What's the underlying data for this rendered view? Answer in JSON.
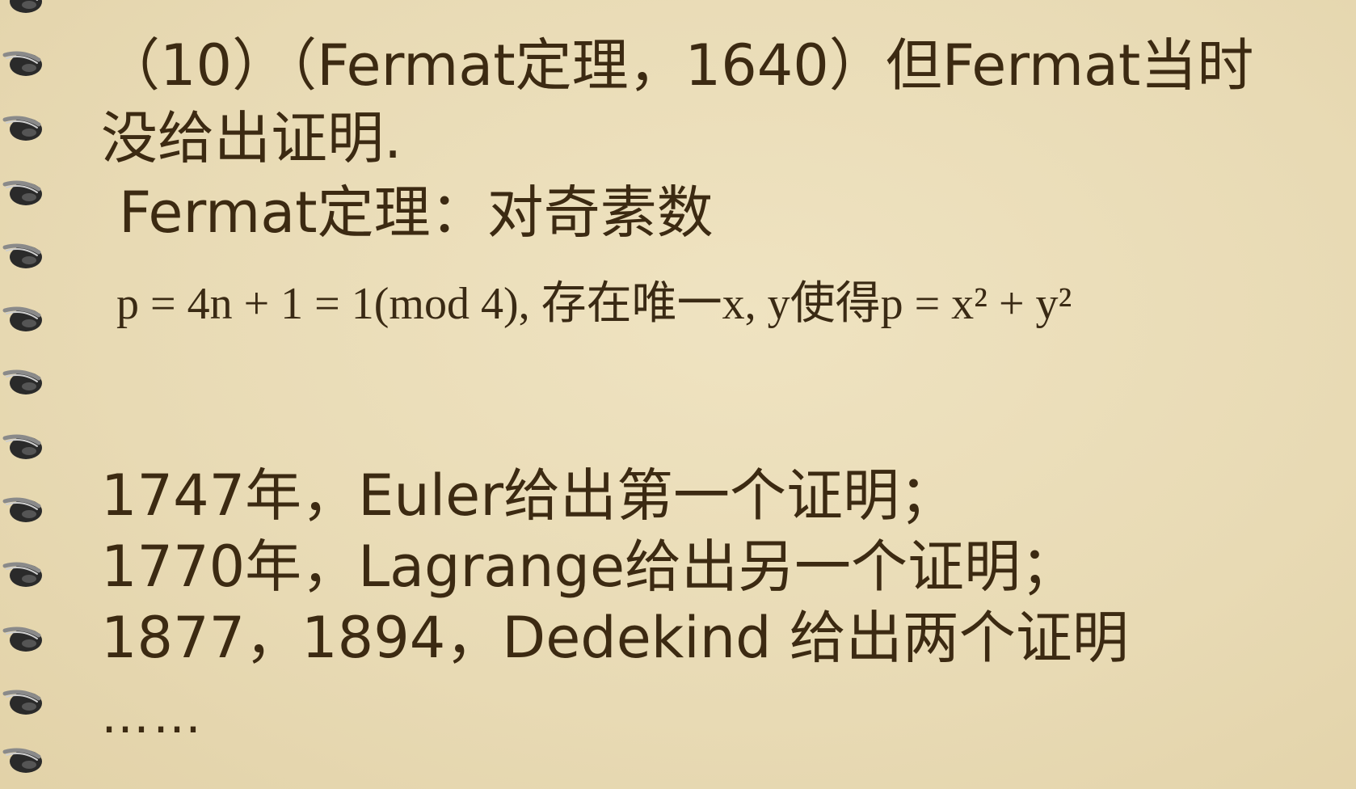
{
  "lines": {
    "l1": "（10）（Fermat定理，1640）但Fermat当时",
    "l2": "没给出证明.",
    "l3": " Fermat定理：对奇素数",
    "l4": "p = 4n + 1 = 1(mod  4), 存在唯一x, y使得p = x² + y²",
    "l5": "1747年，Euler给出第一个证明；",
    "l6": "1770年，Lagrange给出另一个证明；",
    "l7": "1877，1894，Dedekind 给出两个证明",
    "l8": "……"
  },
  "colors": {
    "background": "#e9dcb7",
    "text": "#3c2a12",
    "ring": "#2a2a2a"
  },
  "binding_icon": "spiral-ring-icon"
}
